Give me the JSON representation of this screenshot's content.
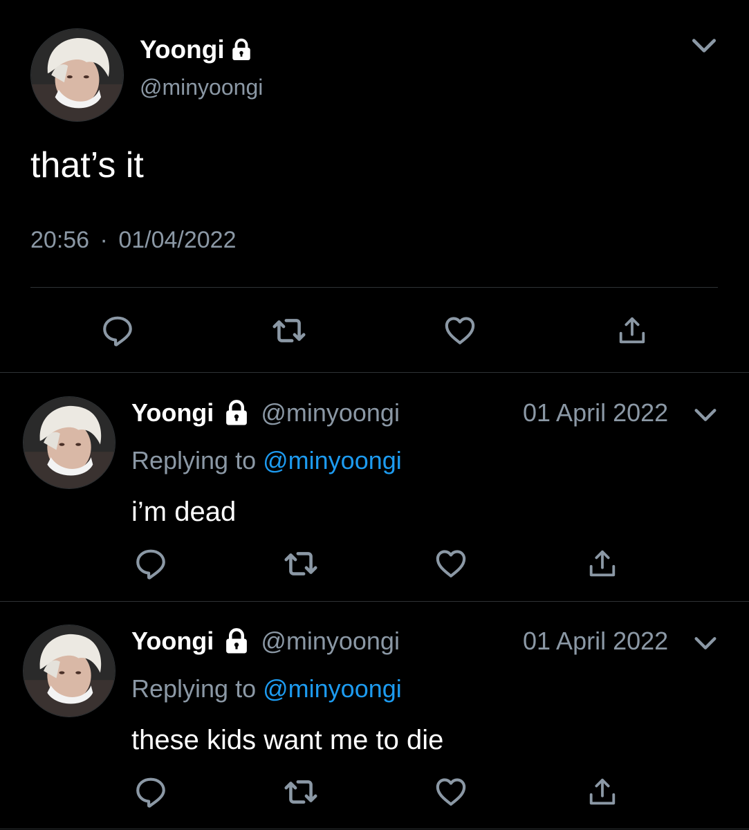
{
  "colors": {
    "background": "#000000",
    "text_primary": "#ffffff",
    "text_secondary": "#8b98a5",
    "link": "#1d9bf0",
    "divider": "#2f3336"
  },
  "main_tweet": {
    "display_name": "Yoongi",
    "handle": "@minyoongi",
    "text": "that’s it",
    "time": "20:56",
    "separator": "·",
    "date": "01/04/2022",
    "icons": [
      "avatar",
      "lock-icon",
      "chevron-down-icon",
      "reply-icon",
      "retweet-icon",
      "like-icon",
      "share-icon"
    ]
  },
  "replies": [
    {
      "display_name": "Yoongi",
      "handle": "@minyoongi",
      "date": "01 April 2022",
      "replying_prefix": "Replying to",
      "replying_to": "@minyoongi",
      "text": "i’m dead"
    },
    {
      "display_name": "Yoongi",
      "handle": "@minyoongi",
      "date": "01 April 2022",
      "replying_prefix": "Replying to",
      "replying_to": "@minyoongi",
      "text": "these kids want me to die"
    }
  ]
}
